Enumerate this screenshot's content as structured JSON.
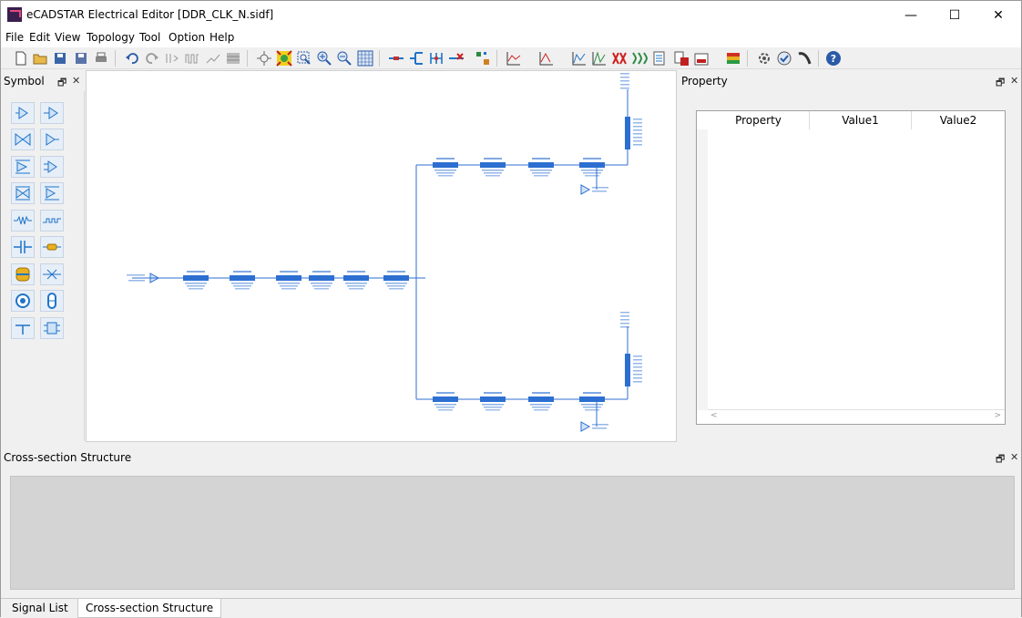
{
  "window": {
    "title": "eCADSTAR Electrical Editor [DDR_CLK_N.sidf]",
    "minimize_glyph": "—",
    "maximize_glyph": "☐",
    "close_glyph": "✕"
  },
  "menu": [
    "File",
    "Edit",
    "View",
    "Topology",
    "Tool",
    "Option",
    "Help"
  ],
  "toolbar_icons": [
    "new-icon",
    "open-icon",
    "save-icon",
    "save-as-icon",
    "print-icon",
    "undo-icon",
    "redo-icon",
    "tool-icon",
    "waveform-icon",
    "sweep-icon",
    "grid-icon",
    "zoom-extents-icon",
    "zoom-fit-icon",
    "zoom-window-icon",
    "zoom-in-icon",
    "zoom-out-icon",
    "grid-toggle-icon",
    "connect-icon",
    "branch-icon",
    "net-icon",
    "delete-net-icon",
    "place-icon",
    "waveform-view-icon",
    "eye-diagram-icon",
    "plot-icon",
    "plot2-icon",
    "crosstalk-icon",
    "coupling-icon",
    "report-icon",
    "export-icon",
    "spice-icon",
    "layer-stack-icon",
    "settings-icon",
    "simulate-icon",
    "probe-icon",
    "help-icon"
  ],
  "symbol_panel": {
    "title": "Symbol",
    "restore_glyph": "🗗",
    "close_glyph": "✕",
    "items": [
      "driver-symbol",
      "receiver-symbol",
      "bidirectional-symbol",
      "io-symbol",
      "diff-driver-symbol",
      "diff-receiver-symbol",
      "diff-bidir-symbol",
      "diff-io-symbol",
      "resistor-symbol",
      "transmission-line-symbol",
      "capacitor-symbol",
      "inductor-symbol",
      "connector-symbol",
      "via-symbol",
      "probe-symbol",
      "coupling-symbol",
      "ground-symbol",
      "package-symbol"
    ]
  },
  "property_panel": {
    "title": "Property",
    "restore_glyph": "🗗",
    "close_glyph": "✕",
    "columns": [
      "Property",
      "Value1",
      "Value2"
    ],
    "scroll_left": "<",
    "scroll_right": ">"
  },
  "cross_section": {
    "title": "Cross-section Structure",
    "restore_glyph": "🗗",
    "close_glyph": "✕"
  },
  "tabs": [
    {
      "label": "Signal List",
      "active": false
    },
    {
      "label": "Cross-section Structure",
      "active": true
    }
  ],
  "colors": {
    "accent": "#1f74c8",
    "schematic": "#2c6fd1"
  }
}
